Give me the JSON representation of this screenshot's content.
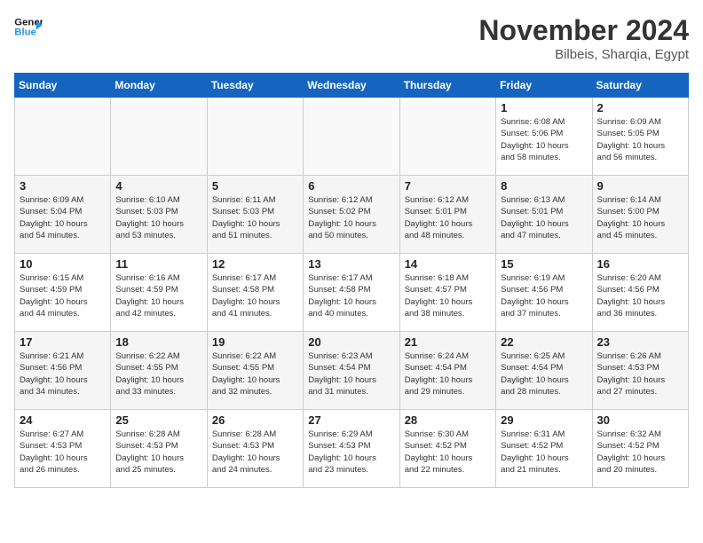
{
  "header": {
    "logo_line1": "General",
    "logo_line2": "Blue",
    "month": "November 2024",
    "location": "Bilbeis, Sharqia, Egypt"
  },
  "days_of_week": [
    "Sunday",
    "Monday",
    "Tuesday",
    "Wednesday",
    "Thursday",
    "Friday",
    "Saturday"
  ],
  "weeks": [
    [
      {
        "day": "",
        "info": ""
      },
      {
        "day": "",
        "info": ""
      },
      {
        "day": "",
        "info": ""
      },
      {
        "day": "",
        "info": ""
      },
      {
        "day": "",
        "info": ""
      },
      {
        "day": "1",
        "info": "Sunrise: 6:08 AM\nSunset: 5:06 PM\nDaylight: 10 hours\nand 58 minutes."
      },
      {
        "day": "2",
        "info": "Sunrise: 6:09 AM\nSunset: 5:05 PM\nDaylight: 10 hours\nand 56 minutes."
      }
    ],
    [
      {
        "day": "3",
        "info": "Sunrise: 6:09 AM\nSunset: 5:04 PM\nDaylight: 10 hours\nand 54 minutes."
      },
      {
        "day": "4",
        "info": "Sunrise: 6:10 AM\nSunset: 5:03 PM\nDaylight: 10 hours\nand 53 minutes."
      },
      {
        "day": "5",
        "info": "Sunrise: 6:11 AM\nSunset: 5:03 PM\nDaylight: 10 hours\nand 51 minutes."
      },
      {
        "day": "6",
        "info": "Sunrise: 6:12 AM\nSunset: 5:02 PM\nDaylight: 10 hours\nand 50 minutes."
      },
      {
        "day": "7",
        "info": "Sunrise: 6:12 AM\nSunset: 5:01 PM\nDaylight: 10 hours\nand 48 minutes."
      },
      {
        "day": "8",
        "info": "Sunrise: 6:13 AM\nSunset: 5:01 PM\nDaylight: 10 hours\nand 47 minutes."
      },
      {
        "day": "9",
        "info": "Sunrise: 6:14 AM\nSunset: 5:00 PM\nDaylight: 10 hours\nand 45 minutes."
      }
    ],
    [
      {
        "day": "10",
        "info": "Sunrise: 6:15 AM\nSunset: 4:59 PM\nDaylight: 10 hours\nand 44 minutes."
      },
      {
        "day": "11",
        "info": "Sunrise: 6:16 AM\nSunset: 4:59 PM\nDaylight: 10 hours\nand 42 minutes."
      },
      {
        "day": "12",
        "info": "Sunrise: 6:17 AM\nSunset: 4:58 PM\nDaylight: 10 hours\nand 41 minutes."
      },
      {
        "day": "13",
        "info": "Sunrise: 6:17 AM\nSunset: 4:58 PM\nDaylight: 10 hours\nand 40 minutes."
      },
      {
        "day": "14",
        "info": "Sunrise: 6:18 AM\nSunset: 4:57 PM\nDaylight: 10 hours\nand 38 minutes."
      },
      {
        "day": "15",
        "info": "Sunrise: 6:19 AM\nSunset: 4:56 PM\nDaylight: 10 hours\nand 37 minutes."
      },
      {
        "day": "16",
        "info": "Sunrise: 6:20 AM\nSunset: 4:56 PM\nDaylight: 10 hours\nand 36 minutes."
      }
    ],
    [
      {
        "day": "17",
        "info": "Sunrise: 6:21 AM\nSunset: 4:56 PM\nDaylight: 10 hours\nand 34 minutes."
      },
      {
        "day": "18",
        "info": "Sunrise: 6:22 AM\nSunset: 4:55 PM\nDaylight: 10 hours\nand 33 minutes."
      },
      {
        "day": "19",
        "info": "Sunrise: 6:22 AM\nSunset: 4:55 PM\nDaylight: 10 hours\nand 32 minutes."
      },
      {
        "day": "20",
        "info": "Sunrise: 6:23 AM\nSunset: 4:54 PM\nDaylight: 10 hours\nand 31 minutes."
      },
      {
        "day": "21",
        "info": "Sunrise: 6:24 AM\nSunset: 4:54 PM\nDaylight: 10 hours\nand 29 minutes."
      },
      {
        "day": "22",
        "info": "Sunrise: 6:25 AM\nSunset: 4:54 PM\nDaylight: 10 hours\nand 28 minutes."
      },
      {
        "day": "23",
        "info": "Sunrise: 6:26 AM\nSunset: 4:53 PM\nDaylight: 10 hours\nand 27 minutes."
      }
    ],
    [
      {
        "day": "24",
        "info": "Sunrise: 6:27 AM\nSunset: 4:53 PM\nDaylight: 10 hours\nand 26 minutes."
      },
      {
        "day": "25",
        "info": "Sunrise: 6:28 AM\nSunset: 4:53 PM\nDaylight: 10 hours\nand 25 minutes."
      },
      {
        "day": "26",
        "info": "Sunrise: 6:28 AM\nSunset: 4:53 PM\nDaylight: 10 hours\nand 24 minutes."
      },
      {
        "day": "27",
        "info": "Sunrise: 6:29 AM\nSunset: 4:53 PM\nDaylight: 10 hours\nand 23 minutes."
      },
      {
        "day": "28",
        "info": "Sunrise: 6:30 AM\nSunset: 4:52 PM\nDaylight: 10 hours\nand 22 minutes."
      },
      {
        "day": "29",
        "info": "Sunrise: 6:31 AM\nSunset: 4:52 PM\nDaylight: 10 hours\nand 21 minutes."
      },
      {
        "day": "30",
        "info": "Sunrise: 6:32 AM\nSunset: 4:52 PM\nDaylight: 10 hours\nand 20 minutes."
      }
    ]
  ]
}
